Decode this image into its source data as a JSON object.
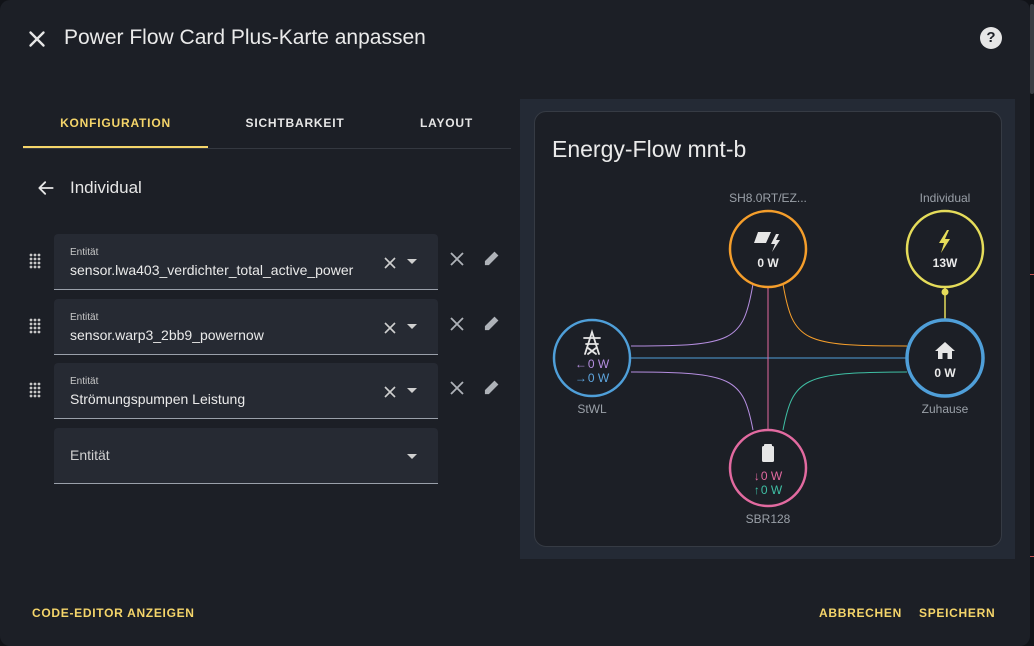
{
  "dialog": {
    "title": "Power Flow Card Plus-Karte anpassen",
    "help_label": "?"
  },
  "tabs": [
    {
      "label": "KONFIGURATION",
      "active": true
    },
    {
      "label": "SICHTBARKEIT",
      "active": false
    },
    {
      "label": "LAYOUT",
      "active": false
    }
  ],
  "subhead": {
    "title": "Individual"
  },
  "entities": [
    {
      "label": "Entität",
      "value": "sensor.lwa403_verdichter_total_active_power"
    },
    {
      "label": "Entität",
      "value": "sensor.warp3_2bb9_powernow"
    },
    {
      "label": "Entität",
      "value": "Strömungspumpen Leistung"
    }
  ],
  "new_entity": {
    "placeholder": "Entität"
  },
  "preview": {
    "title": "Energy-Flow mnt-b",
    "nodes": {
      "solar": {
        "label": "SH8.0RT/EZ...",
        "value": "0 W",
        "color": "#f59e2b",
        "icon": "solar-power-icon"
      },
      "individual": {
        "label": "Individual",
        "value": "13W",
        "color": "#e5dc5a",
        "icon": "lightning-bolt-icon"
      },
      "grid": {
        "label": "StWL",
        "in": "0 W",
        "out": "0 W",
        "in_arrow": "←",
        "out_arrow": "→",
        "color": "#4f9fd9",
        "in_color": "#b58ee0",
        "out_color": "#5ea6df",
        "icon": "transmission-tower-icon"
      },
      "home": {
        "label": "Zuhause",
        "value": "0 W",
        "color": "#4f9fd9",
        "icon": "home-icon"
      },
      "battery": {
        "label": "SBR128",
        "in": "0 W",
        "out": "0 W",
        "in_arrow": "↓",
        "out_arrow": "↑",
        "color": "#e26aa0",
        "in_color": "#e26aa0",
        "out_color": "#3fbfa4",
        "icon": "battery-icon"
      }
    }
  },
  "footer": {
    "code_editor": "CODE-EDITOR ANZEIGEN",
    "cancel": "ABBRECHEN",
    "save": "SPEICHERN"
  },
  "colors": {
    "accent": "#f5d56a",
    "background": "#1c1f26"
  }
}
